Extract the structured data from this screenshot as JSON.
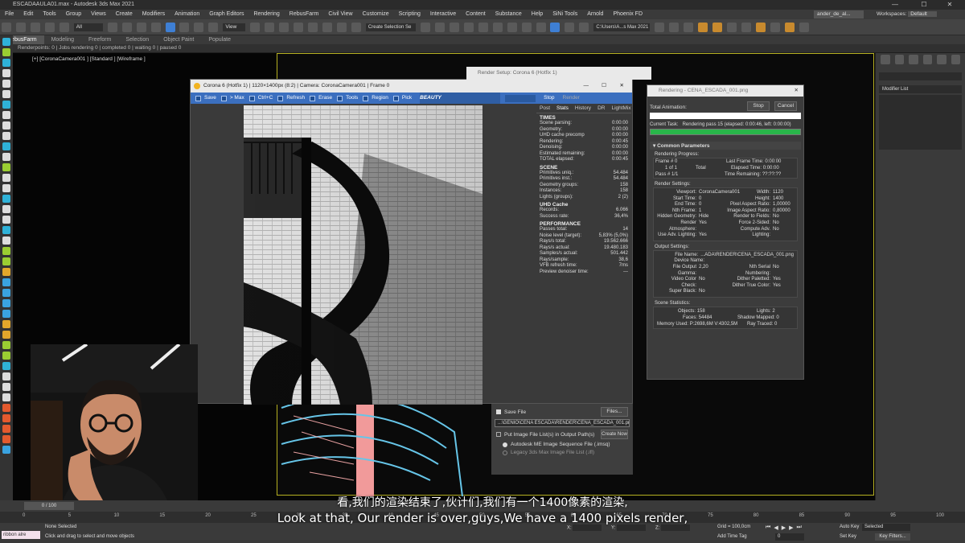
{
  "app": {
    "title": "ESCADAAULA01.max - Autodesk 3ds Max 2021",
    "user": "ander_de_al...",
    "workspaces_label": "Workspaces:",
    "workspace": "Default"
  },
  "menu": [
    "File",
    "Edit",
    "Tools",
    "Group",
    "Views",
    "Create",
    "Modifiers",
    "Animation",
    "Graph Editors",
    "Rendering",
    "RebusFarm",
    "Civil View",
    "Customize",
    "Scripting",
    "Interactive",
    "Content",
    "Substance",
    "Help",
    "SiNi Tools",
    "Arnold",
    "Phoenix FD"
  ],
  "toolbar": {
    "select_filter": "All",
    "view": "View",
    "selection_set": "Create Selection Se",
    "path": "C:\\Users\\A...s Max 2021"
  },
  "ribbon_tabs": [
    "RebusFarm",
    "Modeling",
    "Freeform",
    "Selection",
    "Object Paint",
    "Populate"
  ],
  "render_status": "Renderpoints: 0 | Jobs rendering 0 | completed 0 | waiting 0 | paused 0",
  "viewport": {
    "label": "[+] [CoronaCamera001 ] [Standard ] [Wireframe ]"
  },
  "vfb": {
    "title": "Corona 6 (Hotfix 1) | 1120×1400px (8:2) | Camera: CoronaCamera001 | Frame 0",
    "tools": [
      "Save",
      "> Max",
      "Ctrl+C",
      "Refresh",
      "Erase",
      "Tools",
      "Region",
      "Pick"
    ],
    "channel": "BEAUTY",
    "stop": "Stop",
    "render": "Render",
    "tabs": [
      "Post",
      "Stats",
      "History",
      "DR",
      "LightMix"
    ],
    "times_header": "TIMES",
    "times": [
      {
        "k": "Scene parsing:",
        "v": "0:00:00"
      },
      {
        "k": "Geometry:",
        "v": "0:00:00"
      },
      {
        "k": "UHD cache precomp",
        "v": "0:00:00"
      },
      {
        "k": "Rendering:",
        "v": "0:00:45"
      },
      {
        "k": "Denoising:",
        "v": "0:00:00"
      },
      {
        "k": "Estimated remaining:",
        "v": "0:00:00"
      },
      {
        "k": "TOTAL elapsed:",
        "v": "0:00:45"
      }
    ],
    "scene_header": "SCENE",
    "scene": [
      {
        "k": "Primitives uniq.:",
        "v": "54.484"
      },
      {
        "k": "Primitives inst.:",
        "v": "54.484"
      },
      {
        "k": "Geometry groups:",
        "v": "158"
      },
      {
        "k": "Instances:",
        "v": "158"
      },
      {
        "k": "Lights (groups):",
        "v": "2 (2)"
      }
    ],
    "uhd_header": "UHD Cache",
    "uhd": [
      {
        "k": "Records:",
        "v": "6.066"
      },
      {
        "k": "Success rate:",
        "v": "36,4%"
      }
    ],
    "perf_header": "PERFORMANCE",
    "perf": [
      {
        "k": "Passes total:",
        "v": "14"
      },
      {
        "k": "Noise level (target):",
        "v": "5,83% (5,0%)"
      },
      {
        "k": "Rays/s total:",
        "v": "19.562.666"
      },
      {
        "k": "Rays/s actual:",
        "v": "19.480.183"
      },
      {
        "k": "Samples/s actual:",
        "v": "501.442"
      },
      {
        "k": "Rays/sample:",
        "v": "38,6"
      },
      {
        "k": "VFB refresh time:",
        "v": "7ms"
      },
      {
        "k": "Preview denoiser time:",
        "v": "---"
      }
    ]
  },
  "render_setup": {
    "title": "Render Setup: Corona 6 (Hotfix 1)",
    "save_file": "Save File",
    "files_btn": "Files...",
    "path": "...\\GENIO\\CENA ESCADA\\RENDER\\CENA_ESCADA_001.png",
    "put_image": "Put Image File List(s) in Output Path(s)",
    "create_now": "Create Now",
    "opt1": "Autodesk ME Image Sequence File (.imsq)",
    "opt2": "Legacy 3ds Max Image File List (.ifl)"
  },
  "rendering": {
    "title": "Rendering - CENA_ESCADA_001.png",
    "total_animation": "Total Animation:",
    "stop": "Stop",
    "cancel": "Cancel",
    "current_task_label": "Current Task:",
    "current_task": "Rendering pass 15 (elapsed: 0:00:46, left: 0:00:00)",
    "progress": 1.0,
    "common_params": "Common Parameters",
    "rendering_progress": "Rendering Progress:",
    "frame_label": "Frame #",
    "frame": "0",
    "of_label": "1 of 1",
    "total": "Total",
    "pass_label": "Pass #",
    "pass": "1/1",
    "last_frame_time_label": "Last Frame Time:",
    "last_frame_time": "0:00:00",
    "elapsed_label": "Elapsed Time:",
    "elapsed": "0:00:00",
    "remaining_label": "Time Remaining:",
    "remaining": "??:??:??",
    "render_settings": "Render Settings:",
    "settings_left": [
      {
        "k": "Viewport:",
        "v": "CoronaCamera001"
      },
      {
        "k": "Start Time:",
        "v": "0"
      },
      {
        "k": "End Time:",
        "v": "0"
      },
      {
        "k": "Nth Frame:",
        "v": "1"
      },
      {
        "k": "Hidden Geometry:",
        "v": "Hide"
      },
      {
        "k": "Render Atmosphere:",
        "v": "Yes"
      },
      {
        "k": "Use Adv. Lighting:",
        "v": "Yes"
      }
    ],
    "settings_right": [
      {
        "k": "Width:",
        "v": "1120"
      },
      {
        "k": "Height:",
        "v": "1400"
      },
      {
        "k": "Pixel Aspect Ratio:",
        "v": "1,00000"
      },
      {
        "k": "Image Aspect Ratio:",
        "v": "0,80000"
      },
      {
        "k": "Render to Fields:",
        "v": "No"
      },
      {
        "k": "Force 2-Sided:",
        "v": "No"
      },
      {
        "k": "Compute Adv. Lighting:",
        "v": "No"
      }
    ],
    "output_settings": "Output Settings:",
    "file_name_label": "File Name:",
    "file_name": "...ADA\\RENDER\\CENA_ESCADA_001.png",
    "device_name_label": "Device Name:",
    "output_left": [
      {
        "k": "File Output Gamma:",
        "v": "2,20"
      },
      {
        "k": "Video Color Check:",
        "v": "No"
      },
      {
        "k": "Super Black:",
        "v": "No"
      }
    ],
    "output_right": [
      {
        "k": "Nth Serial Numbering:",
        "v": "No"
      },
      {
        "k": "Dither Paletted:",
        "v": "Yes"
      },
      {
        "k": "Dither True Color:",
        "v": "Yes"
      }
    ],
    "scene_stats": "Scene Statistics:",
    "objects_label": "Objects:",
    "objects": "158",
    "lights_label": "Lights:",
    "lights": "2",
    "faces_label": "Faces:",
    "faces": "54484",
    "shadow_label": "Shadow Mapped:",
    "shadow": "0",
    "memory_label": "Memory Used:",
    "memory": "P:2698,6M V:4302,5M",
    "raytraced_label": "Ray Traced:",
    "raytraced": "0"
  },
  "right_panel": {
    "modifier_list": "Modifier List"
  },
  "timeline": {
    "frame": "0 / 100",
    "ticks": [
      "0",
      "5",
      "10",
      "15",
      "20",
      "25",
      "30",
      "35",
      "40",
      "45",
      "50",
      "55",
      "60",
      "65",
      "70",
      "75",
      "80",
      "85",
      "90",
      "95",
      "100"
    ]
  },
  "status": {
    "maxscript": "ribbon alre",
    "selection": "None Selected",
    "prompt": "Click and drag to select and move objects",
    "x_label": "X:",
    "y_label": "Y:",
    "z_label": "Z:",
    "grid": "Grid = 100,0cm",
    "add_time_tag": "Add Time Tag",
    "auto_key": "Auto Key",
    "selected": "Selected",
    "set_key": "Set Key",
    "key_filters": "Key Filters...",
    "frame_input": "0"
  },
  "subtitles": {
    "zh": "看,我们的渲染结束了,伙计们,我们有一个1400像素的渲染,",
    "en": "Look at that, Our render is over,guys,We have a 1400 pixels render,"
  }
}
